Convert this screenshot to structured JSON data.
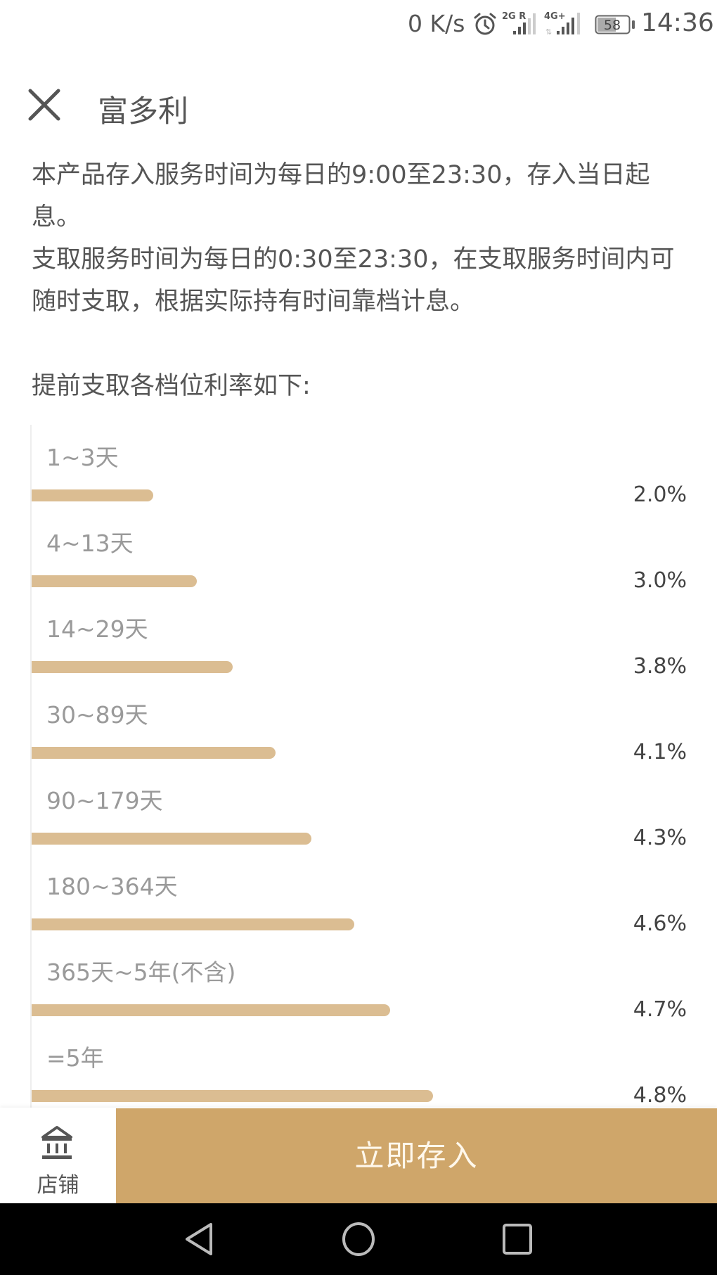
{
  "status_bar": {
    "net_speed": "0 K/s",
    "icons": [
      "alarm-icon",
      "signal-2g-roaming-icon",
      "signal-4g-plus-icon",
      "battery-icon"
    ],
    "network_1": "2G R",
    "network_2": "4G+",
    "battery": "58",
    "time": "14:36"
  },
  "header": {
    "close_icon": "close-icon",
    "title": "富多利"
  },
  "description": {
    "paragraph_1": "本产品存入服务时间为每日的9:00至23:30，存入当日起息。",
    "paragraph_2": "支取服务时间为每日的0:30至23:30，在支取服务时间内可随时支取，根据实际持有时间靠档计息。"
  },
  "rates_heading": "提前支取各档位利率如下:",
  "chart_data": {
    "type": "bar",
    "orientation": "horizontal",
    "title": "提前支取各档位利率如下:",
    "categories": [
      "1~3天",
      "4~13天",
      "14~29天",
      "30~89天",
      "90~179天",
      "180~364天",
      "365天~5年(不含)",
      "=5年"
    ],
    "values": [
      2.0,
      3.0,
      3.8,
      4.1,
      4.3,
      4.6,
      4.7,
      4.8
    ],
    "value_labels": [
      "2.0%",
      "3.0%",
      "3.8%",
      "4.1%",
      "4.3%",
      "4.6%",
      "4.7%",
      "4.8%"
    ],
    "unit": "%",
    "bar_fill_fraction": [
      0.17,
      0.23,
      0.28,
      0.34,
      0.39,
      0.45,
      0.5,
      0.56
    ],
    "xlabel": "",
    "ylabel": "",
    "grid": false,
    "legend": "none",
    "bar_color": "#dbbd92"
  },
  "bottom_bar": {
    "store_icon": "bank-store-icon",
    "store_label": "店铺",
    "deposit_label": "立即存入",
    "accent_color": "#cfa66a"
  },
  "nav_bar": {
    "icons": [
      "back-icon",
      "home-icon",
      "recents-icon"
    ]
  }
}
